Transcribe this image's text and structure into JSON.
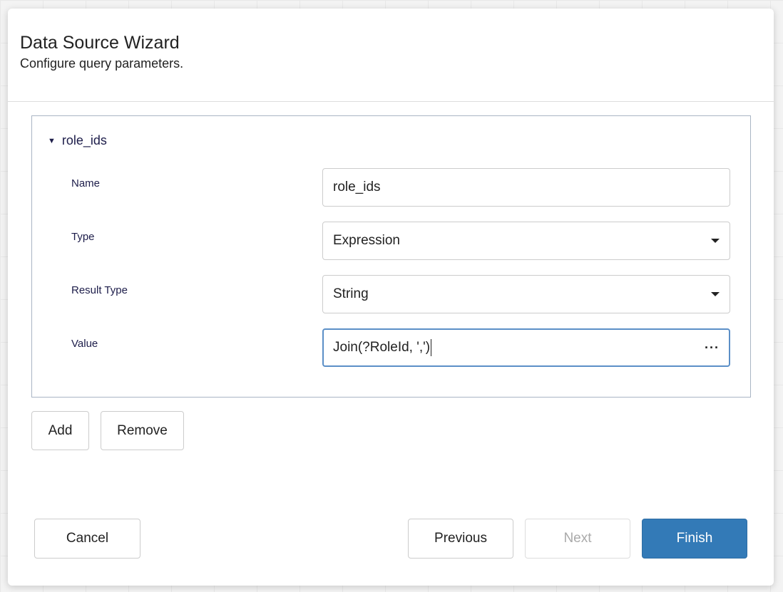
{
  "dialog": {
    "title": "Data Source Wizard",
    "subtitle": "Configure query parameters."
  },
  "parameter": {
    "group_label": "role_ids",
    "fields": [
      {
        "label": "Name",
        "value": "role_ids"
      },
      {
        "label": "Type",
        "value": "Expression"
      },
      {
        "label": "Result Type",
        "value": "String"
      },
      {
        "label": "Value",
        "value": "Join(?RoleId, ',')"
      }
    ]
  },
  "actions": {
    "add": "Add",
    "remove": "Remove"
  },
  "footer": {
    "cancel": "Cancel",
    "previous": "Previous",
    "next": "Next",
    "finish": "Finish"
  },
  "colors": {
    "accent": "#337ab7",
    "focus_border": "#5b8fc7"
  }
}
